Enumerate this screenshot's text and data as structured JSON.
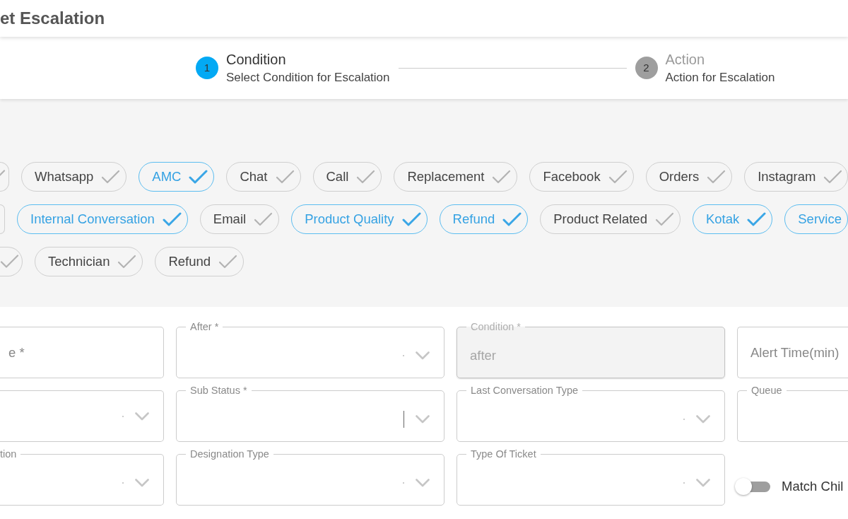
{
  "header": {
    "title": "et Escalation"
  },
  "stepper": {
    "steps": [
      {
        "number": "1",
        "title": "Condition",
        "subtitle": "Select Condition for Escalation",
        "active": true
      },
      {
        "number": "2",
        "title": "Action",
        "subtitle": "Action for Escalation",
        "active": false
      }
    ]
  },
  "chip_rows": [
    {
      "chips": [
        {
          "selected": false
        },
        {
          "label": "Whatsapp",
          "selected": false
        },
        {
          "label": "AMC",
          "selected": true
        },
        {
          "label": "Chat",
          "selected": false
        },
        {
          "label": "Call",
          "selected": false
        },
        {
          "label": "Replacement",
          "selected": false
        },
        {
          "label": "Facebook",
          "selected": false
        },
        {
          "label": "Orders",
          "selected": false
        },
        {
          "label": "Instagram",
          "selected": false
        }
      ]
    },
    {
      "chips": [
        {
          "selected": false
        },
        {
          "label": "Internal Conversation",
          "selected": true
        },
        {
          "label": "Email",
          "selected": false
        },
        {
          "label": "Product Quality",
          "selected": true
        },
        {
          "label": "Refund",
          "selected": true
        },
        {
          "label": "Product Related",
          "selected": false
        },
        {
          "label": "Kotak",
          "selected": true
        },
        {
          "label": "Service",
          "selected": true
        }
      ]
    },
    {
      "chips": [
        {
          "selected": false
        },
        {
          "label": "Technician",
          "selected": false
        },
        {
          "label": "Refund",
          "selected": false
        }
      ]
    }
  ],
  "fields": [
    {
      "kind": "text",
      "placeholder": "e *",
      "disabled": false
    },
    {
      "kind": "select",
      "label": "After *",
      "focused": false,
      "disabled": false
    },
    {
      "kind": "text",
      "label": "Condition *",
      "value": "after",
      "disabled": true
    },
    {
      "kind": "text",
      "placeholder": "Alert Time(min)",
      "disabled": false
    },
    {
      "kind": "select",
      "focused": false,
      "disabled": false
    },
    {
      "kind": "select",
      "label": "Sub Status *",
      "focused": true,
      "disabled": false
    },
    {
      "kind": "select",
      "label": "Last Conversation Type",
      "focused": false,
      "disabled": false
    },
    {
      "kind": "text",
      "label": "Queue",
      "disabled": false
    },
    {
      "kind": "select",
      "label": "tion",
      "focused": false,
      "disabled": false
    },
    {
      "kind": "select",
      "label": "Designation Type",
      "focused": false,
      "disabled": false
    },
    {
      "kind": "select",
      "label": "Type Of Ticket",
      "focused": false,
      "disabled": false
    },
    {
      "kind": "toggle",
      "label": "Match Chil",
      "on": false
    }
  ]
}
